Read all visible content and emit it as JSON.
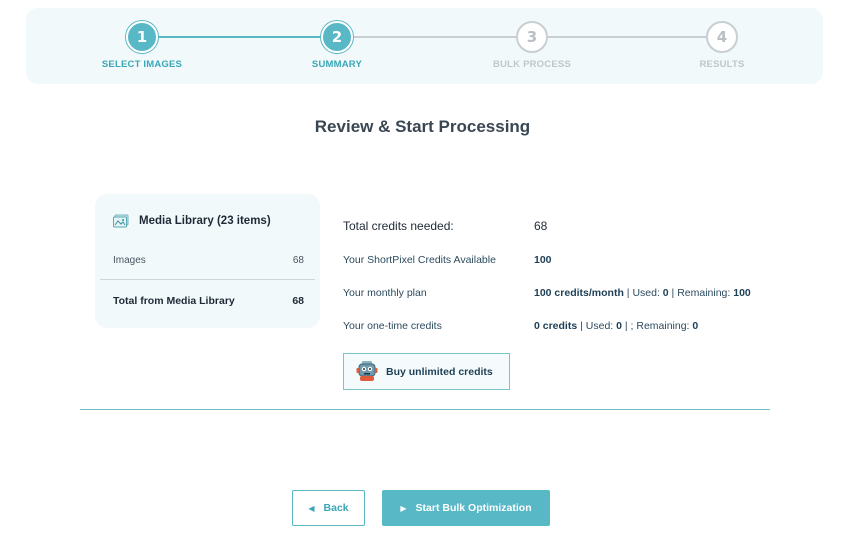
{
  "stepper": {
    "steps": [
      {
        "number": "1",
        "label": "SELECT IMAGES",
        "state": "active"
      },
      {
        "number": "2",
        "label": "SUMMARY",
        "state": "active"
      },
      {
        "number": "3",
        "label": "BULK PROCESS",
        "state": "inactive"
      },
      {
        "number": "4",
        "label": "RESULTS",
        "state": "inactive"
      }
    ]
  },
  "page_title": "Review & Start Processing",
  "media_card": {
    "title": "Media Library (23 items)",
    "icon": "image-icon",
    "rows": [
      {
        "label": "Images",
        "value": "68"
      }
    ],
    "total_label": "Total from Media Library",
    "total_value": "68"
  },
  "credits": {
    "total_label": "Total credits needed:",
    "total_value": "68",
    "available_label": "Your ShortPixel Credits Available",
    "available_value": "100",
    "monthly_label": "Your monthly plan",
    "monthly": {
      "credits": "100 credits/month",
      "used_label": "Used:",
      "used": "0",
      "remaining_label": "Remaining:",
      "remaining": "100"
    },
    "onetime_label": "Your one-time credits",
    "onetime": {
      "credits": "0 credits",
      "used_label": "Used:",
      "used": "0",
      "remaining_label": "; Remaining:",
      "remaining": "0"
    }
  },
  "buy_button": {
    "label": "Buy unlimited credits",
    "icon": "robot-icon"
  },
  "buttons": {
    "back": "Back",
    "start": "Start Bulk Optimization"
  },
  "colors": {
    "accent": "#58b8c6",
    "panel": "#f1f9fa",
    "inactive": "#c9ced2"
  }
}
